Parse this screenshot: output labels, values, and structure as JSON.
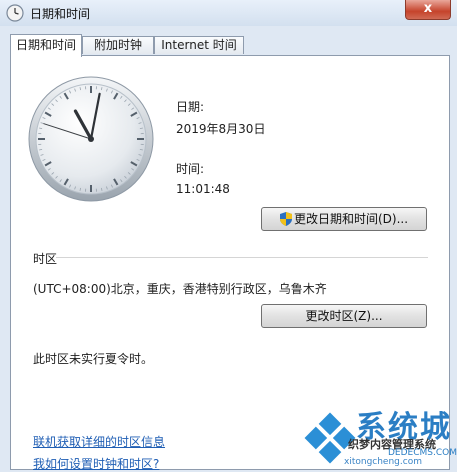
{
  "window": {
    "title": "日期和时间",
    "close_glyph": "x"
  },
  "tabs": [
    {
      "label": "日期和时间",
      "active": true
    },
    {
      "label": "附加时钟",
      "active": false
    },
    {
      "label": "Internet 时间",
      "active": false
    }
  ],
  "date_section": {
    "label": "日期:",
    "value": "2019年8月30日"
  },
  "time_section": {
    "label": "时间:",
    "value": "11:01:48"
  },
  "clock": {
    "hours": 11,
    "minutes": 1,
    "seconds": 48
  },
  "change_datetime_button": "更改日期和时间(D)...",
  "timezone": {
    "header": "时区",
    "value": "(UTC+08:00)北京，重庆，香港特别行政区，乌鲁木齐",
    "change_button": "更改时区(Z)...",
    "dst_note": "此时区未实行夏令时。"
  },
  "links": [
    "联机获取详细的时区信息",
    "我如何设置时钟和时区?"
  ],
  "watermark": {
    "big_text": "系统城",
    "cms_text": "织梦内容管理系统",
    "url_text": "DEDECMS.COM",
    "site_text": "xitongcheng.com"
  },
  "colors": {
    "link": "#1f5eb4",
    "accent": "#2b7ec4",
    "close": "#c5432b"
  }
}
